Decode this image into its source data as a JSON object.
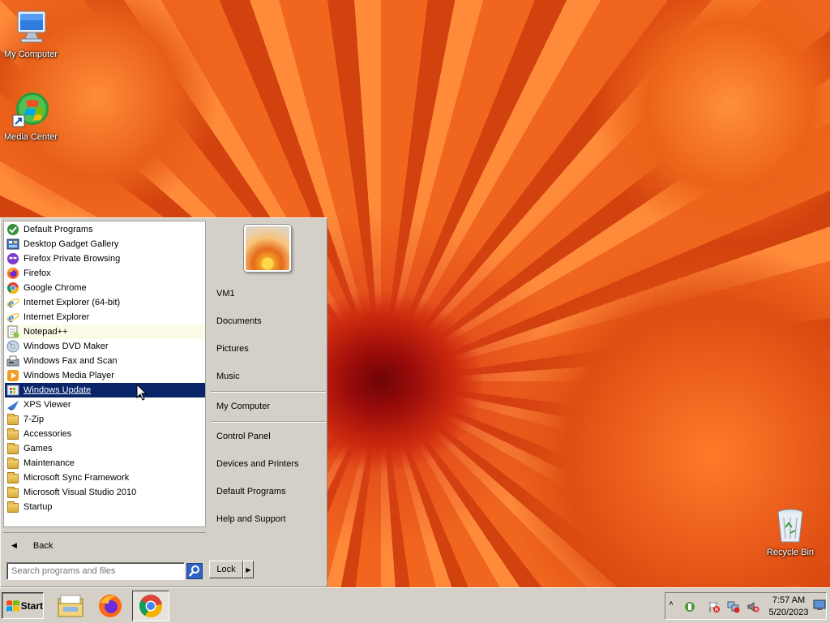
{
  "desktop": {
    "icons": [
      {
        "label": "My Computer"
      },
      {
        "label": "Media Center"
      },
      {
        "label": "Recycle Bin"
      }
    ]
  },
  "start_menu": {
    "programs": [
      {
        "label": "Default Programs",
        "icon": "default-programs-icon"
      },
      {
        "label": "Desktop Gadget Gallery",
        "icon": "gadget-gallery-icon"
      },
      {
        "label": "Firefox Private Browsing",
        "icon": "firefox-private-icon"
      },
      {
        "label": "Firefox",
        "icon": "firefox-icon"
      },
      {
        "label": "Google Chrome",
        "icon": "chrome-icon"
      },
      {
        "label": "Internet Explorer (64-bit)",
        "icon": "internet-explorer-icon"
      },
      {
        "label": "Internet Explorer",
        "icon": "internet-explorer-icon"
      },
      {
        "label": "Notepad++",
        "icon": "notepad-plus-plus-icon"
      },
      {
        "label": "Windows DVD Maker",
        "icon": "dvd-maker-icon"
      },
      {
        "label": "Windows Fax and Scan",
        "icon": "fax-scan-icon"
      },
      {
        "label": "Windows Media Player",
        "icon": "media-player-icon"
      },
      {
        "label": "Windows Update",
        "icon": "windows-update-icon"
      },
      {
        "label": "XPS Viewer",
        "icon": "xps-viewer-icon"
      },
      {
        "label": "7-Zip",
        "icon": "folder-icon"
      },
      {
        "label": "Accessories",
        "icon": "folder-icon"
      },
      {
        "label": "Games",
        "icon": "folder-icon"
      },
      {
        "label": "Maintenance",
        "icon": "folder-icon"
      },
      {
        "label": "Microsoft Sync Framework",
        "icon": "folder-icon"
      },
      {
        "label": "Microsoft Visual Studio 2010",
        "icon": "folder-icon"
      },
      {
        "label": "Startup",
        "icon": "folder-icon"
      }
    ],
    "highlighted_program": "Windows Update",
    "back_label": "Back",
    "search": {
      "placeholder": "Search programs and files"
    },
    "right_pane": {
      "user": "VM1",
      "items": [
        "Documents",
        "Pictures",
        "Music",
        "My Computer",
        "Control Panel",
        "Devices and Printers",
        "Default Programs",
        "Help and Support"
      ]
    },
    "lock_label": "Lock"
  },
  "taskbar": {
    "start_label": "Start",
    "pinned": [
      {
        "name": "explorer",
        "icon": "folder-explorer-icon"
      },
      {
        "name": "firefox",
        "icon": "firefox-icon"
      },
      {
        "name": "chrome",
        "icon": "chrome-icon"
      }
    ],
    "clock": {
      "time": "7:57 AM",
      "date": "5/20/2023"
    }
  },
  "colors": {
    "highlight": "#0a246a",
    "menu_bg": "#d4d0c8",
    "wallpaper": "#e8561a"
  }
}
